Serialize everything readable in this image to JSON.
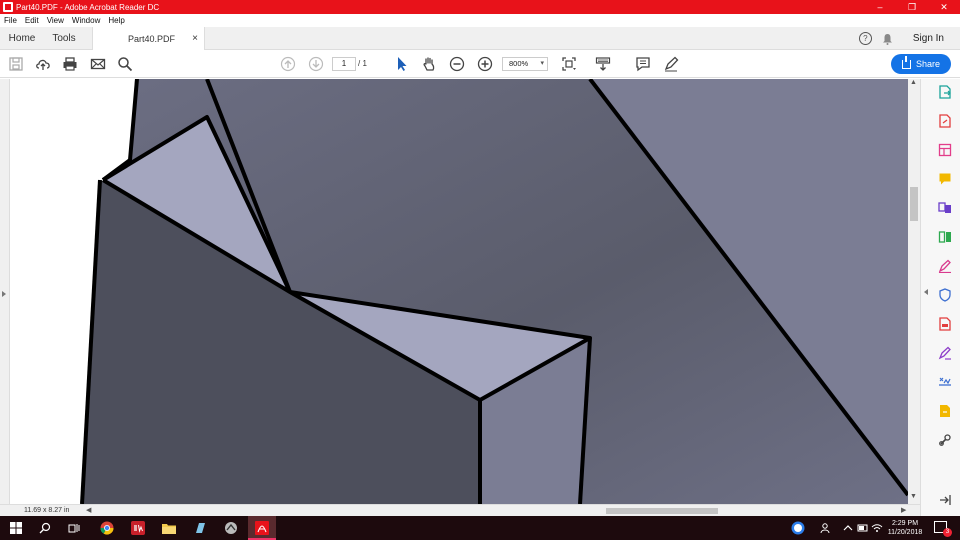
{
  "window": {
    "title": "Part40.PDF - Adobe Acrobat Reader DC",
    "controls": [
      "–",
      "❐",
      "✕"
    ]
  },
  "menu": [
    "File",
    "Edit",
    "View",
    "Window",
    "Help"
  ],
  "tabs": {
    "home": "Home",
    "tools": "Tools",
    "document": "Part40.PDF",
    "close": "×"
  },
  "header_right": {
    "help": "?",
    "sign_in": "Sign In"
  },
  "toolbar": {
    "page_current": "1",
    "page_total": "/  1",
    "zoom": "800%",
    "share_label": "Share"
  },
  "status": {
    "page_dims": "11.69 x 8.27 in"
  },
  "clock": {
    "time": "2:29 PM",
    "date": "11/20/2018"
  },
  "notifications": {
    "count": "3"
  },
  "colors": {
    "titlebar": "#e8121a",
    "accent": "#1473e6",
    "taskbar": "#1d0a0d",
    "face_light": "#a4a6bf",
    "face_mid": "#5b5d6e",
    "face_dark": "#4d4f5c",
    "face_right": "#7b7d94"
  }
}
